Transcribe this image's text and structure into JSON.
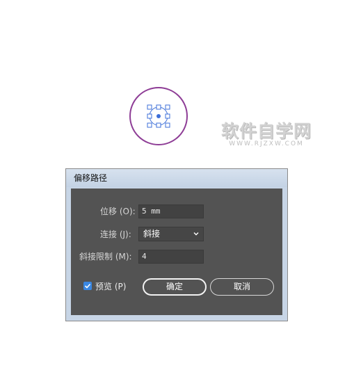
{
  "watermark": {
    "main": "软件自学网",
    "sub": "WWW.RJZXW.COM"
  },
  "dialog": {
    "title": "偏移路径",
    "offset": {
      "label": "位移 (O):",
      "value": "5 mm"
    },
    "join": {
      "label": "连接 (J):",
      "selected": "斜接"
    },
    "miter_limit": {
      "label": "斜接限制 (M):",
      "value": "4"
    },
    "preview": {
      "label": "预览 (P)",
      "checked": true
    },
    "ok_label": "确定",
    "cancel_label": "取消"
  },
  "colors": {
    "circle_stroke": "#8e3d96",
    "selection_blue": "#3d6fd8",
    "dialog_panel": "#535353",
    "accent_checkbox": "#3a87e2"
  }
}
